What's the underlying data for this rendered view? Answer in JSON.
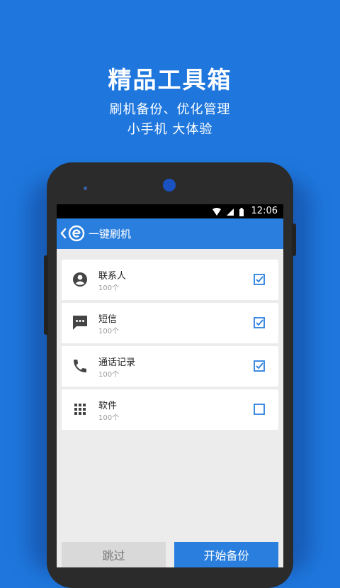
{
  "promo": {
    "title": "精品工具箱",
    "subtitle_line1": "刷机备份、优化管理",
    "subtitle_line2": "小手机 大体验"
  },
  "status_bar": {
    "time": "12:06",
    "icons": [
      "wifi-icon",
      "signal-icon",
      "battery-icon"
    ]
  },
  "app_bar": {
    "title": "一键刷机",
    "back_icon": "chevron-left-icon",
    "logo_icon": "app-logo-icon"
  },
  "items": [
    {
      "name": "联系人",
      "count": "100个",
      "icon": "contact-icon",
      "checked": true
    },
    {
      "name": "短信",
      "count": "100个",
      "icon": "message-icon",
      "checked": true
    },
    {
      "name": "通话记录",
      "count": "100个",
      "icon": "phone-icon",
      "checked": true
    },
    {
      "name": "软件",
      "count": "100个",
      "icon": "apps-grid-icon",
      "checked": false
    }
  ],
  "buttons": {
    "skip": "跳过",
    "start": "开始备份"
  },
  "colors": {
    "background": "#1f77dd",
    "accent": "#2a7fde",
    "screen_bg": "#ececec"
  }
}
